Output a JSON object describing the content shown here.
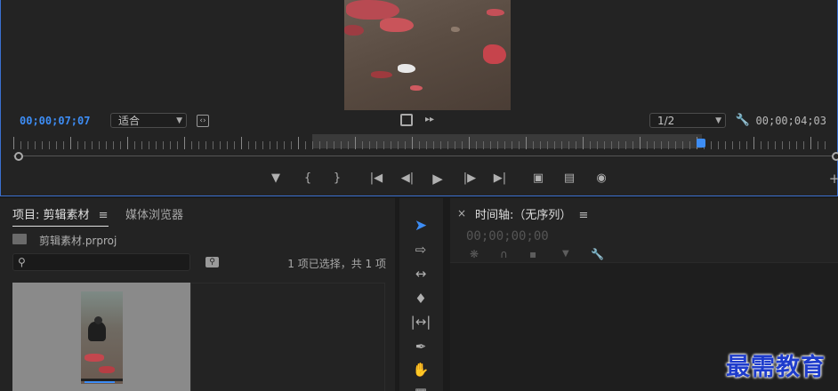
{
  "monitor": {
    "current_timecode": "00;00;07;07",
    "duration_timecode": "00;00;04;03",
    "fit_dropdown": "适合",
    "resolution_dropdown": "1/2"
  },
  "project_panel": {
    "tab_project": "项目: 剪辑素材",
    "tab_media_browser": "媒体浏览器",
    "project_file": "剪辑素材.prproj",
    "selection_status": "1 项已选择，共 1 项"
  },
  "timeline_panel": {
    "close_label": "×",
    "title": "时间轴:（无序列）",
    "timecode": "00;00;00;00"
  },
  "menu_glyph": "≡",
  "watermark": "最需教育",
  "colors": {
    "accent_blue": "#3d8df5",
    "panel_bg": "#232323",
    "focus_border": "#3a6fcf"
  }
}
